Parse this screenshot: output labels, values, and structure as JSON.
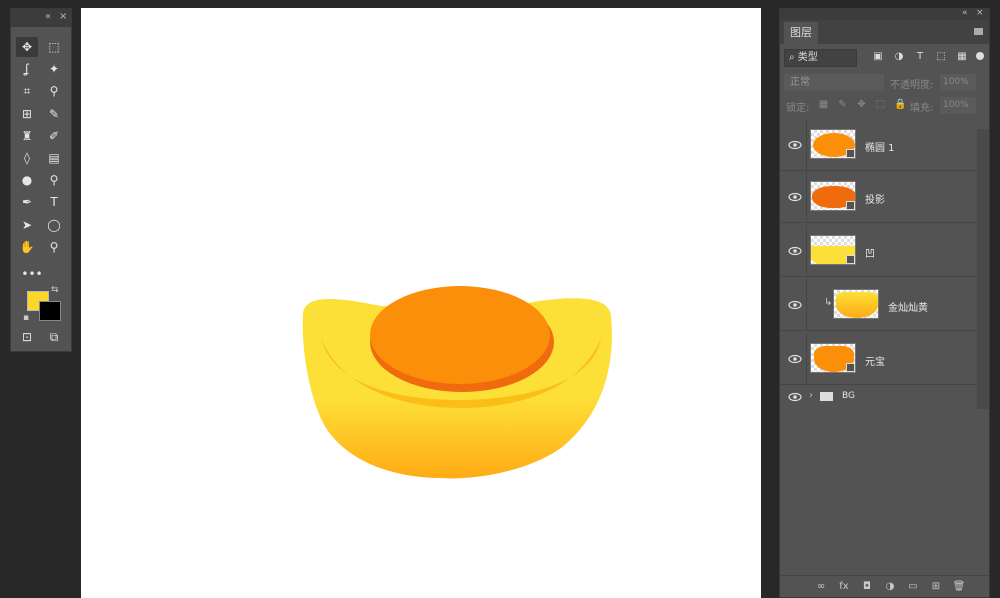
{
  "colors": {
    "foreground": "#fcd62a",
    "background": "#000000",
    "ingot_top": "#fde037",
    "ingot_bottom": "#ffab15",
    "orange": "#fb8f0a",
    "orange_dark": "#f06a0e"
  },
  "toolbar": {
    "collapse_label": "«",
    "close_label": "×",
    "more_label": "•••",
    "tools": [
      {
        "icon": "move-icon",
        "glyph": "✥"
      },
      {
        "icon": "marquee-icon",
        "glyph": "⬚"
      },
      {
        "icon": "lasso-icon",
        "glyph": "ʆ"
      },
      {
        "icon": "magic-wand-icon",
        "glyph": "✦"
      },
      {
        "icon": "crop-icon",
        "glyph": "⌗"
      },
      {
        "icon": "eyedropper-icon",
        "glyph": "⚲"
      },
      {
        "icon": "healing-brush-icon",
        "glyph": "⊞"
      },
      {
        "icon": "brush-icon",
        "glyph": "✎"
      },
      {
        "icon": "stamp-icon",
        "glyph": "♜"
      },
      {
        "icon": "history-brush-icon",
        "glyph": "✐"
      },
      {
        "icon": "eraser-icon",
        "glyph": "◊"
      },
      {
        "icon": "gradient-icon",
        "glyph": "▤"
      },
      {
        "icon": "blur-icon",
        "glyph": "●"
      },
      {
        "icon": "dodge-icon",
        "glyph": "⚲"
      },
      {
        "icon": "pen-icon",
        "glyph": "✒"
      },
      {
        "icon": "type-icon",
        "glyph": "T"
      },
      {
        "icon": "path-selection-icon",
        "glyph": "➤"
      },
      {
        "icon": "ellipse-icon",
        "glyph": "◯"
      },
      {
        "icon": "hand-icon",
        "glyph": "✋"
      },
      {
        "icon": "zoom-icon",
        "glyph": "⚲"
      }
    ],
    "bottom_tools": [
      {
        "icon": "quick-mask-icon",
        "glyph": "⊡"
      },
      {
        "icon": "screen-mode-icon",
        "glyph": "⧉"
      }
    ]
  },
  "layers_panel": {
    "collapse_label": "«",
    "close_label": "×",
    "tab_label": "图层",
    "filter_label": "⌕ 类型",
    "filter_icons": [
      {
        "icon": "pixel-filter-icon",
        "glyph": "▣"
      },
      {
        "icon": "adjustment-filter-icon",
        "glyph": "◑"
      },
      {
        "icon": "type-filter-icon",
        "glyph": "T"
      },
      {
        "icon": "shape-filter-icon",
        "glyph": "⬚"
      },
      {
        "icon": "smart-object-filter-icon",
        "glyph": "▦"
      }
    ],
    "blend_mode": "正常",
    "opacity_label": "不透明度:",
    "opacity_value": "100%",
    "lock_label": "锁定:",
    "lock_icons": [
      {
        "icon": "lock-transparent-icon",
        "glyph": "▦"
      },
      {
        "icon": "lock-pixels-icon",
        "glyph": "✎"
      },
      {
        "icon": "lock-position-icon",
        "glyph": "✥"
      },
      {
        "icon": "lock-artboard-icon",
        "glyph": "⬚"
      },
      {
        "icon": "lock-all-icon",
        "glyph": "🔒"
      }
    ],
    "fill_label": "填充:",
    "fill_value": "100%",
    "layers": [
      {
        "name": "椭圆 1"
      },
      {
        "name": "投影"
      },
      {
        "name": "凹"
      },
      {
        "name": "金灿灿黄"
      },
      {
        "name": "元宝"
      }
    ],
    "group": {
      "name": "BG",
      "chevron": "›"
    },
    "bottom_icons": [
      {
        "icon": "link-icon",
        "glyph": "∞"
      },
      {
        "icon": "fx-icon",
        "glyph": "fx"
      },
      {
        "icon": "add-mask-icon",
        "glyph": "◘"
      },
      {
        "icon": "adjustment-layer-icon",
        "glyph": "◑"
      },
      {
        "icon": "new-group-icon",
        "glyph": "▭"
      },
      {
        "icon": "new-layer-icon",
        "glyph": "⊞"
      },
      {
        "icon": "delete-layer-icon",
        "glyph": "🗑"
      }
    ]
  }
}
